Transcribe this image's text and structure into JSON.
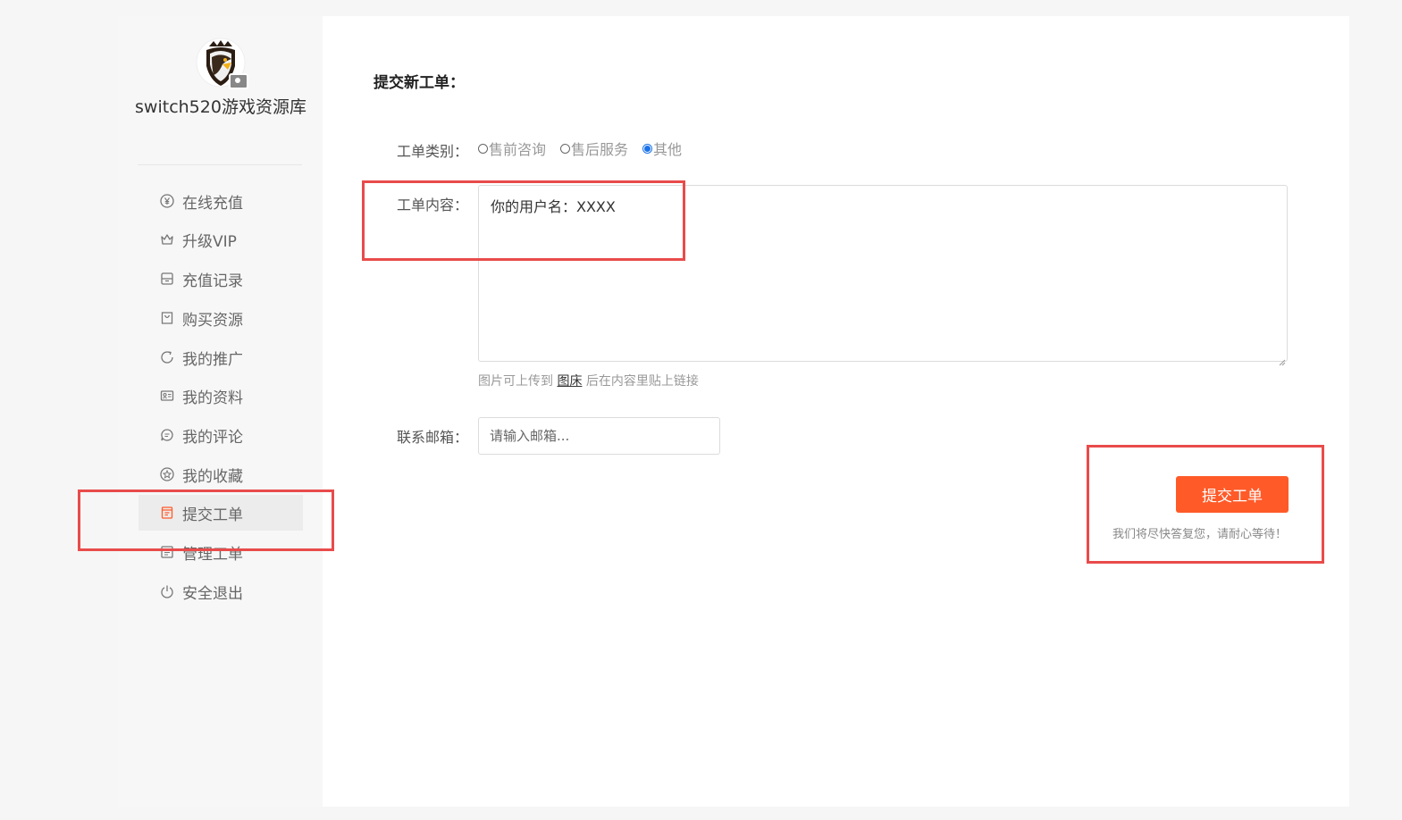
{
  "site": {
    "name": "switch520游戏资源库"
  },
  "sidebar": {
    "items": [
      {
        "label": "在线充值",
        "icon": "yen-circle-icon",
        "active": false
      },
      {
        "label": "升级VIP",
        "icon": "crown-icon",
        "active": false
      },
      {
        "label": "充值记录",
        "icon": "archive-icon",
        "active": false
      },
      {
        "label": "购买资源",
        "icon": "shopping-bag-icon",
        "active": false
      },
      {
        "label": "我的推广",
        "icon": "refresh-circle-icon",
        "active": false
      },
      {
        "label": "我的资料",
        "icon": "id-card-icon",
        "active": false
      },
      {
        "label": "我的评论",
        "icon": "comment-icon",
        "active": false
      },
      {
        "label": "我的收藏",
        "icon": "star-circle-icon",
        "active": false
      },
      {
        "label": "提交工单",
        "icon": "ticket-icon",
        "active": true
      },
      {
        "label": "管理工单",
        "icon": "list-icon",
        "active": false
      },
      {
        "label": "安全退出",
        "icon": "power-icon",
        "active": false
      }
    ]
  },
  "form": {
    "title": "提交新工单：",
    "type_label": "工单类别：",
    "type_options": [
      {
        "label": "售前咨询",
        "checked": false
      },
      {
        "label": "售后服务",
        "checked": false
      },
      {
        "label": "其他",
        "checked": true
      }
    ],
    "content_label": "工单内容：",
    "content_value": "你的用户名：XXXX",
    "hint_prefix": "图片可上传到",
    "hint_link": "图床",
    "hint_suffix": "后在内容里贴上链接",
    "email_label": "联系邮箱：",
    "email_placeholder": "请输入邮箱...",
    "submit_label": "提交工单",
    "submit_note": "我们将尽快答复您，请耐心等待！"
  },
  "colors": {
    "accent": "#ff5a28",
    "highlight": "#e94b4b",
    "radio_checked": "#1a73e8"
  }
}
